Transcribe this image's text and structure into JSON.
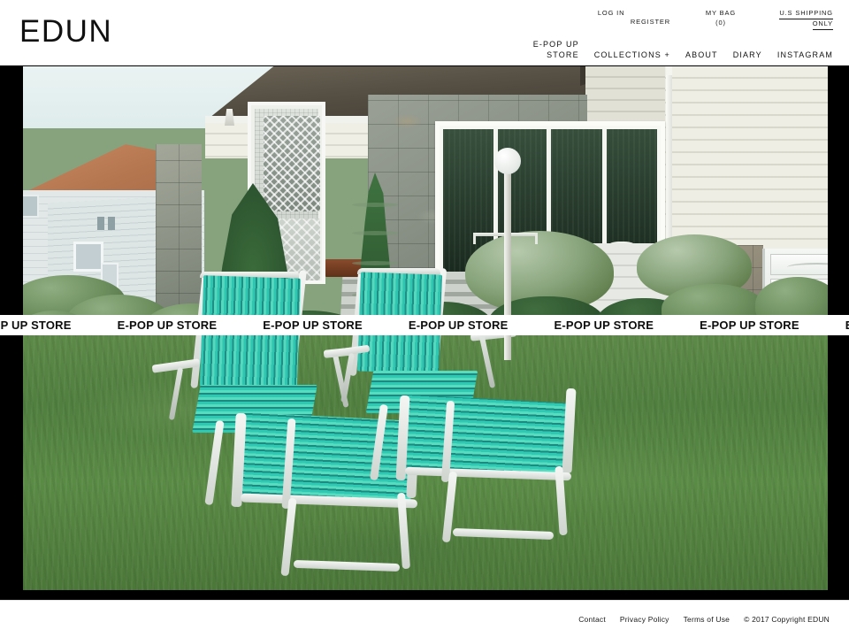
{
  "site": {
    "logo": "EDUN"
  },
  "utility_nav": {
    "login": "LOG IN",
    "register": "REGISTER",
    "bag": "MY BAG (0)",
    "bag_label": "MY BAG",
    "bag_count": "(0)",
    "shipping_line1": "U.S SHIPPING",
    "shipping_line2": "ONLY"
  },
  "main_nav": {
    "epop_line1": "E-POP UP",
    "epop_line2": "STORE",
    "items": [
      {
        "label": "COLLECTIONS +"
      },
      {
        "label": "ABOUT"
      },
      {
        "label": "DIARY"
      },
      {
        "label": "INSTAGRAM"
      }
    ]
  },
  "marquee": {
    "text": "E-POP UP STORE",
    "repeat": 8
  },
  "hero": {
    "alt": "Two vintage turquoise webbed lounge chairs on a suburban front lawn with stone-faced ranch house, topiary shrubs and white globe lamppost"
  },
  "footer": {
    "links": [
      {
        "label": "Contact"
      },
      {
        "label": "Privacy Policy"
      },
      {
        "label": "Terms of Use"
      }
    ],
    "copyright": "© 2017 Copyright EDUN"
  },
  "colors": {
    "page_background": "#000000",
    "surface": "#ffffff",
    "text": "#111111",
    "chair_teal": "#2ec6b0",
    "grass_green": "#507f3f"
  }
}
